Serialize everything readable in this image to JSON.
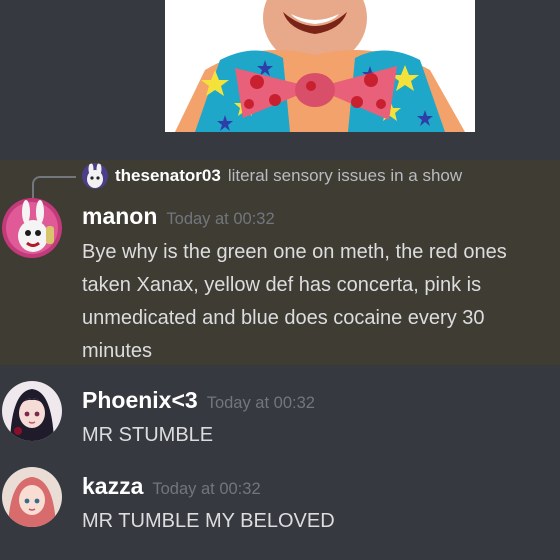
{
  "reply": {
    "username": "thesenator03",
    "text": "literal sensory issues in a show"
  },
  "messages": [
    {
      "username": "manon",
      "timestamp": "Today at 00:32",
      "text": "Bye why is the green one on meth, the red ones taken Xanax, yellow def has concerta, pink is unmedicated and blue does cocaine every 30 minutes"
    },
    {
      "username": "Phoenix<3",
      "timestamp": "Today at 00:32",
      "text": "MR STUMBLE"
    },
    {
      "username": "kazza",
      "timestamp": "Today at 00:32",
      "text": "MR TUMBLE MY BELOVED"
    }
  ],
  "colors": {
    "background": "#36393f",
    "highlight": "#3f3c34",
    "username": "#ffffff",
    "timestamp": "#72767d",
    "message_text": "#dcddde"
  }
}
